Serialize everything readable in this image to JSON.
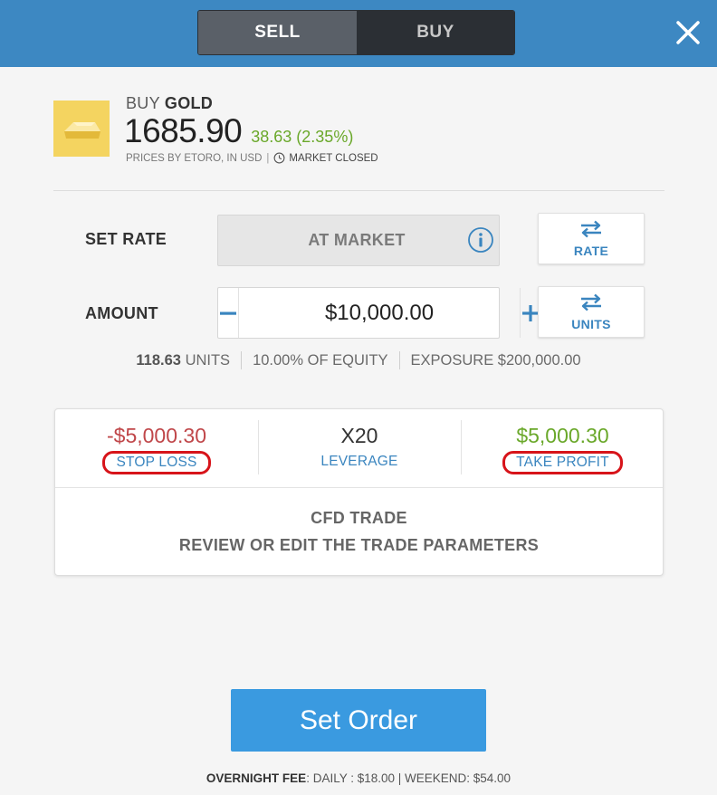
{
  "header": {
    "sell_label": "SELL",
    "buy_label": "BUY",
    "colors": {
      "bar": "#3d88c2",
      "sell_active": "#5a6068",
      "buy_inactive": "#2b2f34"
    }
  },
  "instrument": {
    "action": "BUY",
    "asset": "GOLD",
    "price": "1685.90",
    "change": "38.63 (2.35%)",
    "prices_by": "PRICES BY ETORO, IN USD",
    "separator": "|",
    "market_status": "MARKET CLOSED",
    "logo_icon": "gold-bar-icon",
    "colors": {
      "change": "#6aa82a"
    }
  },
  "set_rate": {
    "label": "SET RATE",
    "value": "AT MARKET",
    "toggle_label": "RATE"
  },
  "amount": {
    "label": "AMOUNT",
    "value": "$10,000.00",
    "toggle_label": "UNITS"
  },
  "summary": {
    "units_value": "118.63",
    "units_label": "UNITS",
    "equity": "10.00% OF EQUITY",
    "exposure": "EXPOSURE $200,000.00"
  },
  "params": {
    "stop_loss_value": "-$5,000.30",
    "stop_loss_label": "STOP LOSS",
    "leverage_value": "X20",
    "leverage_label": "LEVERAGE",
    "take_profit_value": "$5,000.30",
    "take_profit_label": "TAKE PROFIT",
    "trade_type": "CFD TRADE",
    "review_text": "REVIEW OR EDIT THE TRADE PARAMETERS",
    "colors": {
      "stop_loss": "#c0474a",
      "take_profit": "#6aa82a",
      "link": "#3a85bf",
      "annotation_circle": "#d7141a"
    }
  },
  "footer": {
    "set_order_label": "Set Order",
    "fee_label": "OVERNIGHT FEE",
    "fee_detail": ": DAILY : $18.00 | WEEKEND: $54.00",
    "colors": {
      "button": "#3a9ae0"
    }
  }
}
